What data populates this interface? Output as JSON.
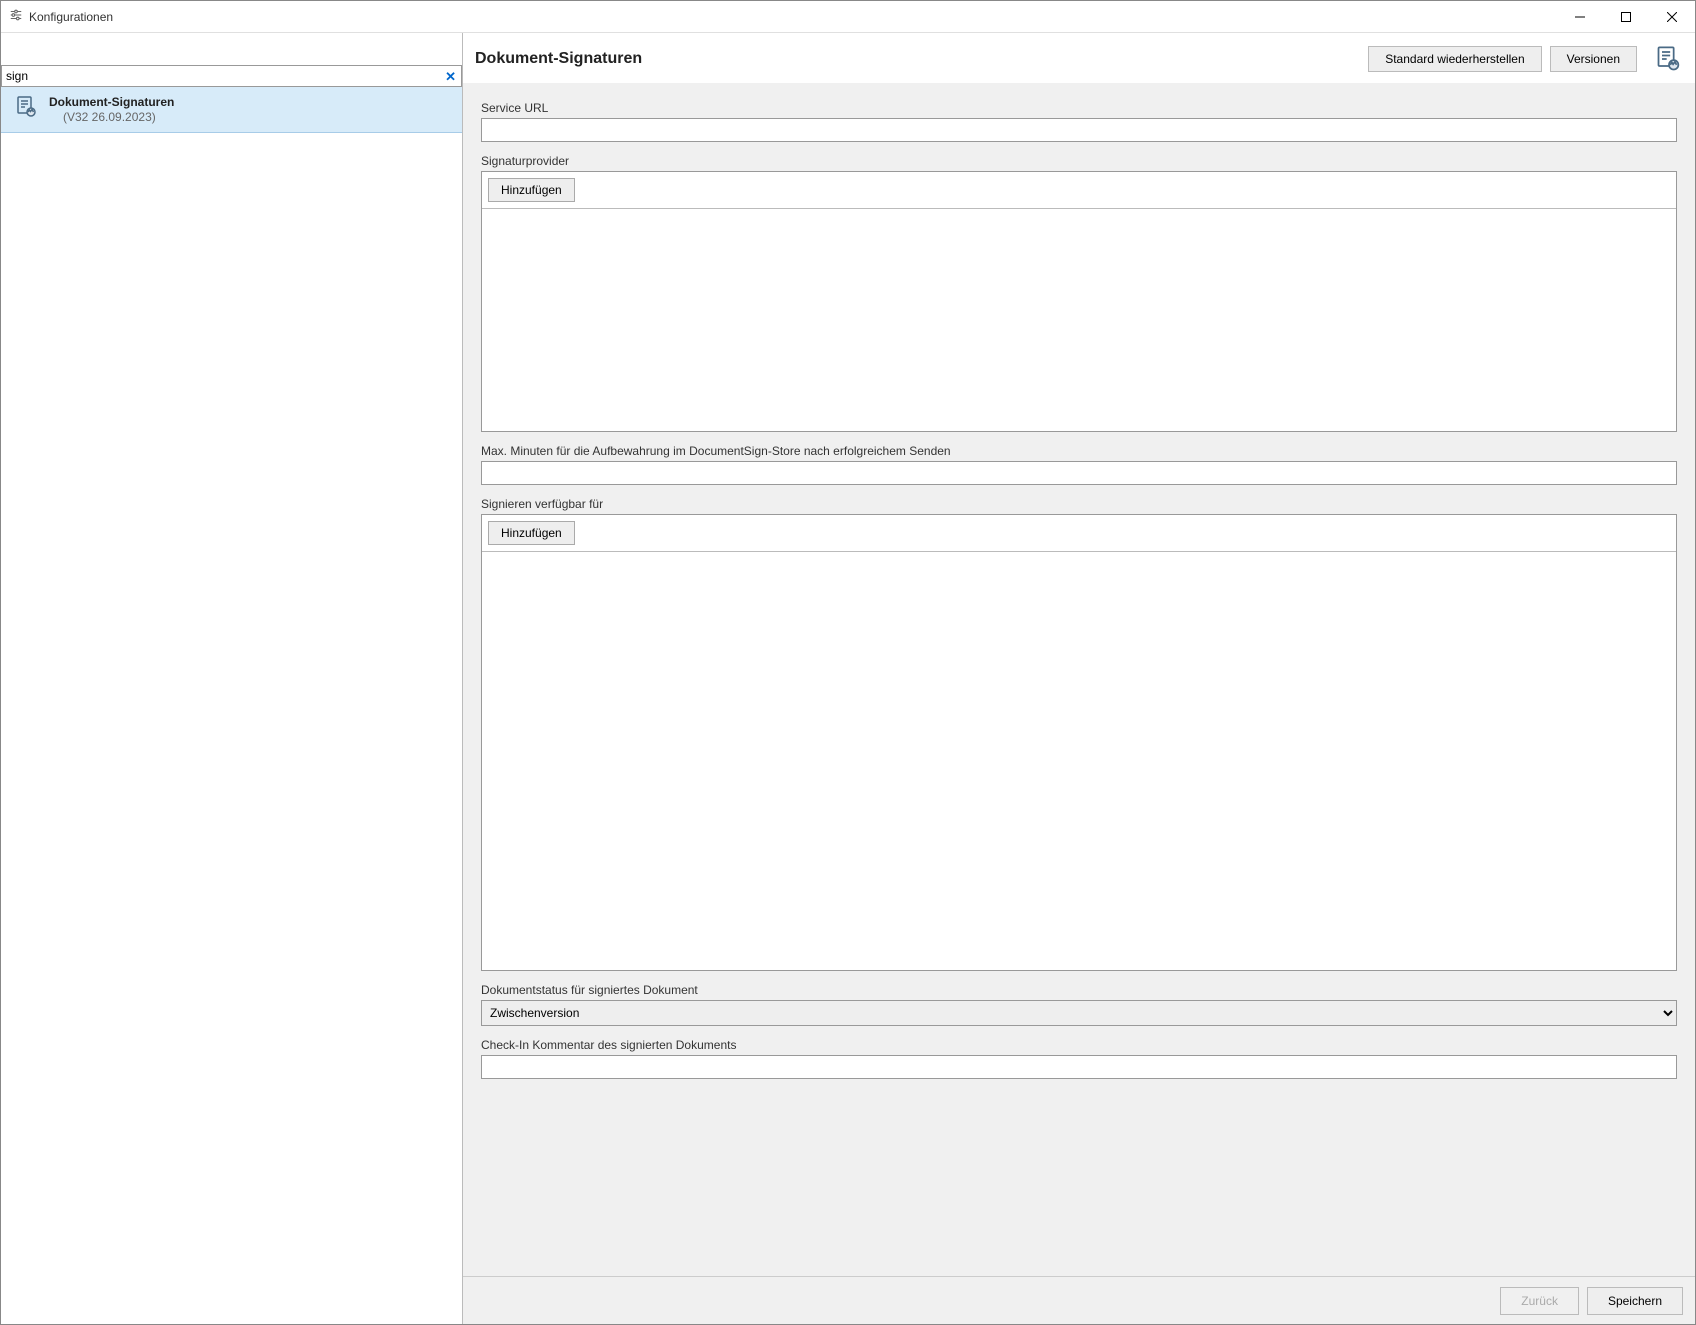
{
  "window": {
    "title": "Konfigurationen"
  },
  "sidebar": {
    "search_value": "sign",
    "item": {
      "label": "Dokument-Signaturen",
      "version": "(V32 26.09.2023)"
    }
  },
  "header": {
    "title": "Dokument-Signaturen",
    "restore_default": "Standard wiederherstellen",
    "versions": "Versionen"
  },
  "form": {
    "service_url_label": "Service URL",
    "service_url_value": "",
    "signatureprovider_label": "Signaturprovider",
    "add_button1": "Hinzufügen",
    "max_minutes_label": "Max. Minuten für die Aufbewahrung im DocumentSign-Store nach erfolgreichem Senden",
    "max_minutes_value": "",
    "sign_available_label": "Signieren verfügbar für",
    "add_button2": "Hinzufügen",
    "docstatus_label": "Dokumentstatus für signiertes Dokument",
    "docstatus_value": "Zwischenversion",
    "checkin_comment_label": "Check-In Kommentar des signierten Dokuments",
    "checkin_comment_value": ""
  },
  "footer": {
    "back": "Zurück",
    "save": "Speichern"
  }
}
